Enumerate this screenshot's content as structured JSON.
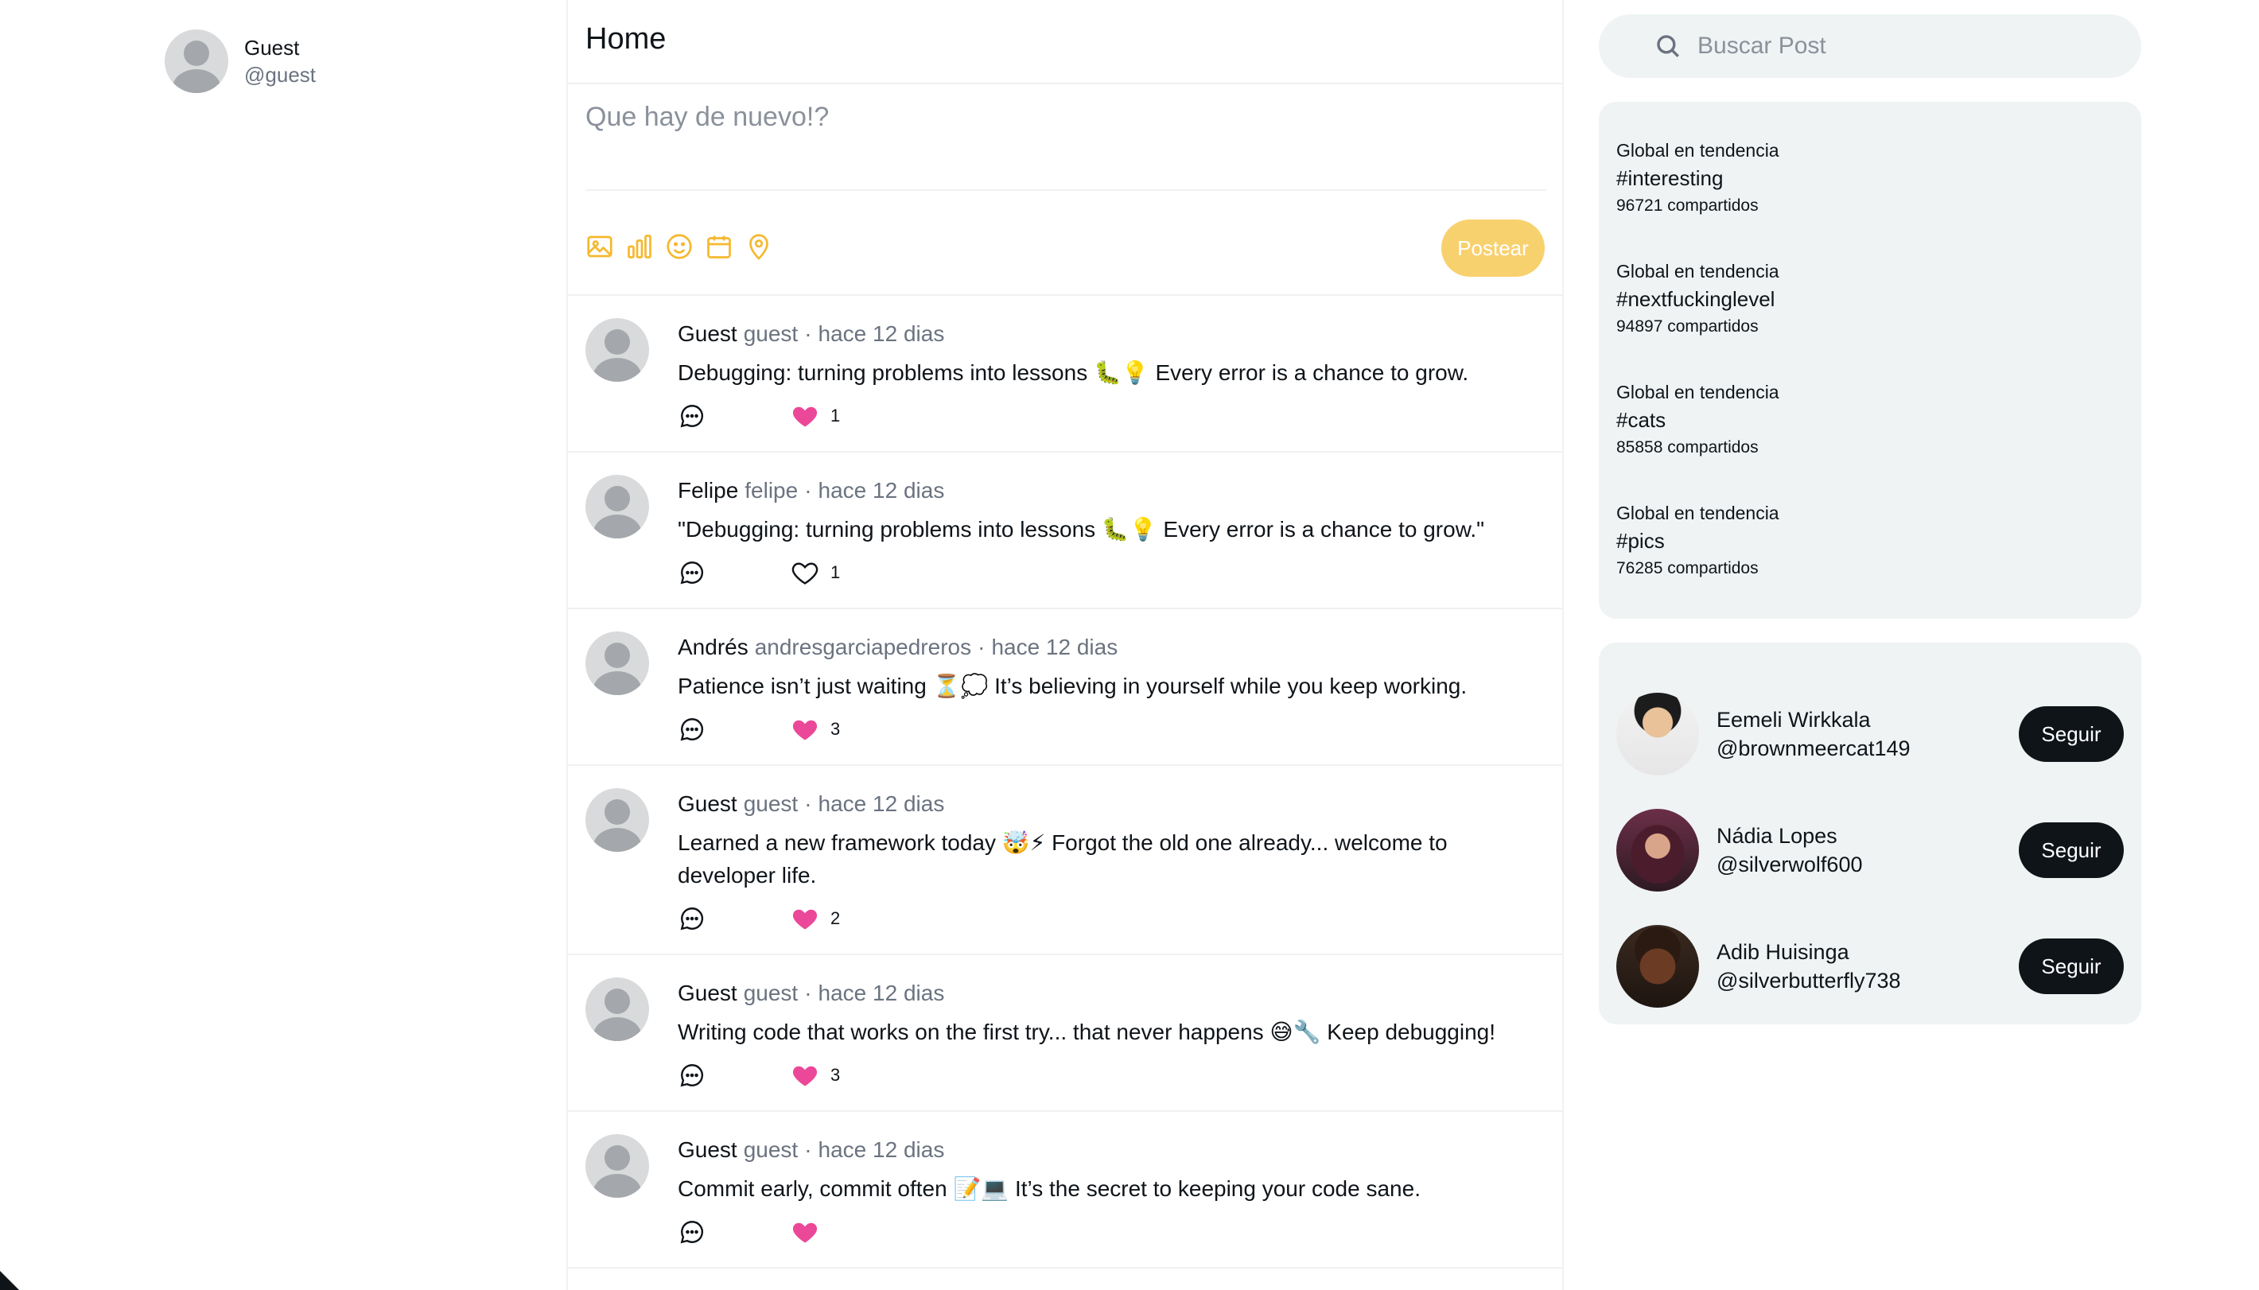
{
  "user": {
    "name": "Guest",
    "handle": "@guest"
  },
  "header": {
    "title": "Home"
  },
  "composer": {
    "placeholder": "Que hay de nuevo!?",
    "tools": [
      "image-icon",
      "poll-icon",
      "emoji-icon",
      "schedule-icon",
      "location-icon"
    ],
    "post_label": "Postear"
  },
  "colors": {
    "accent": "#f5b82e",
    "accent_light": "#f8d16f",
    "like": "#ec4899",
    "panel": "#eff3f4"
  },
  "posts": [
    {
      "name": "Guest",
      "handle": "guest",
      "dot": "·",
      "time": "hace 12 dias",
      "text": "Debugging: turning problems into lessons 🐛💡 Every error is a chance to grow.",
      "likes": "1",
      "liked": true
    },
    {
      "name": "Felipe",
      "handle": "felipe",
      "dot": "·",
      "time": "hace 12 dias",
      "text": "\"Debugging: turning problems into lessons 🐛💡 Every error is a chance to grow.\"",
      "likes": "1",
      "liked": false
    },
    {
      "name": "Andrés",
      "handle": "andresgarciapedreros",
      "dot": "·",
      "time": "hace 12 dias",
      "text": "Patience isn’t just waiting ⏳💭 It’s believing in yourself while you keep working.",
      "likes": "3",
      "liked": true
    },
    {
      "name": "Guest",
      "handle": "guest",
      "dot": "·",
      "time": "hace 12 dias",
      "text": "Learned a new framework today 🤯⚡ Forgot the old one already... welcome to developer life.",
      "likes": "2",
      "liked": true
    },
    {
      "name": "Guest",
      "handle": "guest",
      "dot": "·",
      "time": "hace 12 dias",
      "text": "Writing code that works on the first try... that never happens 😅🔧 Keep debugging!",
      "likes": "3",
      "liked": true
    },
    {
      "name": "Guest",
      "handle": "guest",
      "dot": "·",
      "time": "hace 12 dias",
      "text": "Commit early, commit often 📝💻 It’s the secret to keeping your code sane.",
      "likes": "",
      "liked": true
    }
  ],
  "search": {
    "placeholder": "Buscar Post"
  },
  "trends": [
    {
      "context": "Global en tendencia",
      "tag": "#interesting",
      "count": "96721 compartidos"
    },
    {
      "context": "Global en tendencia",
      "tag": "#nextfuckinglevel",
      "count": "94897 compartidos"
    },
    {
      "context": "Global en tendencia",
      "tag": "#cats",
      "count": "85858 compartidos"
    },
    {
      "context": "Global en tendencia",
      "tag": "#pics",
      "count": "76285 compartidos"
    }
  ],
  "suggestions": [
    {
      "name": "Eemeli Wirkkala",
      "handle": "@brownmeercat149",
      "button": "Seguir"
    },
    {
      "name": "Nádia Lopes",
      "handle": "@silverwolf600",
      "button": "Seguir"
    },
    {
      "name": "Adib Huisinga",
      "handle": "@silverbutterfly738",
      "button": "Seguir"
    }
  ]
}
